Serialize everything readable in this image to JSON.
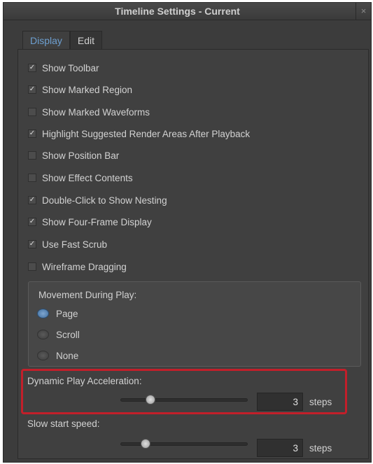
{
  "window": {
    "title": "Timeline Settings - Current",
    "close_glyph": "×"
  },
  "tabs": [
    {
      "label": "Display",
      "active": true
    },
    {
      "label": "Edit",
      "active": false
    }
  ],
  "checkboxes": [
    {
      "label": "Show Toolbar",
      "checked": true
    },
    {
      "label": "Show Marked Region",
      "checked": true
    },
    {
      "label": "Show Marked Waveforms",
      "checked": false
    },
    {
      "label": "Highlight Suggested Render Areas After Playback",
      "checked": true
    },
    {
      "label": "Show Position Bar",
      "checked": false
    },
    {
      "label": "Show Effect Contents",
      "checked": false
    },
    {
      "label": "Double-Click to Show Nesting",
      "checked": true
    },
    {
      "label": "Show Four-Frame Display",
      "checked": true
    },
    {
      "label": "Use Fast Scrub",
      "checked": true
    },
    {
      "label": "Wireframe Dragging",
      "checked": false
    }
  ],
  "movement": {
    "title": "Movement During Play:",
    "options": [
      {
        "label": "Page",
        "selected": true
      },
      {
        "label": "Scroll",
        "selected": false
      },
      {
        "label": "None",
        "selected": false
      }
    ]
  },
  "dynamic_play": {
    "label": "Dynamic Play Acceleration:",
    "value": "3",
    "units": "steps",
    "slider_fraction": 0.21
  },
  "slow_start": {
    "label": "Slow start speed:",
    "value": "3",
    "units": "steps",
    "slider_fraction": 0.17
  },
  "colors": {
    "accent": "#6d9fd0",
    "highlight": "#c21f2a",
    "background": "#3c3c3c"
  },
  "check_glyph": "✓"
}
